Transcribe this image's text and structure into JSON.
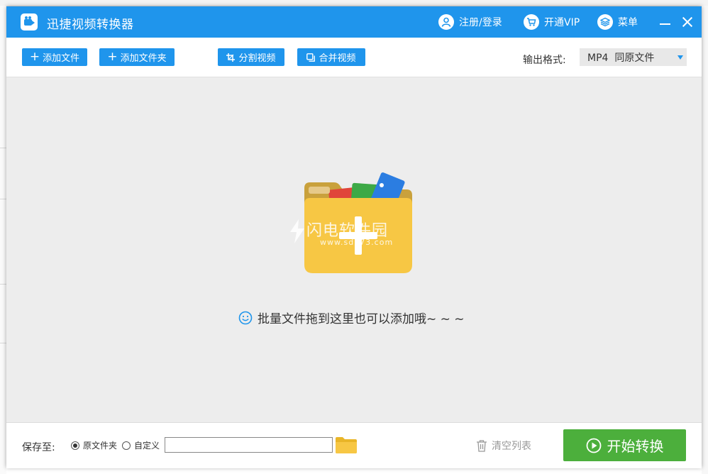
{
  "colors": {
    "accent": "#1f95ec",
    "start_green": "#4caf3c",
    "folder_yellow": "#f7c744"
  },
  "app": {
    "title": "迅捷视频转换器"
  },
  "titlebar": {
    "register_login": "注册/登录",
    "vip": "开通VIP",
    "menu": "菜单",
    "icons": {
      "user": "user-icon",
      "vip": "cart-icon",
      "menu": "layers-icon"
    }
  },
  "toolbar": {
    "add_file": "添加文件",
    "add_folder": "添加文件夹",
    "split_video": "分割视频",
    "merge_video": "合并视频",
    "output_format_label": "输出格式:",
    "output_format_value": "MP4  同原文件"
  },
  "droparea": {
    "watermark_main": "闪电软件园",
    "watermark_sub": "www.sd173.com",
    "hint": "批量文件拖到这里也可以添加哦~ ~ ~"
  },
  "bottom": {
    "save_to_label": "保存至:",
    "option_original": "原文件夹",
    "option_custom": "自定义",
    "path_value": "",
    "clear_list": "清空列表",
    "start": "开始转换"
  }
}
